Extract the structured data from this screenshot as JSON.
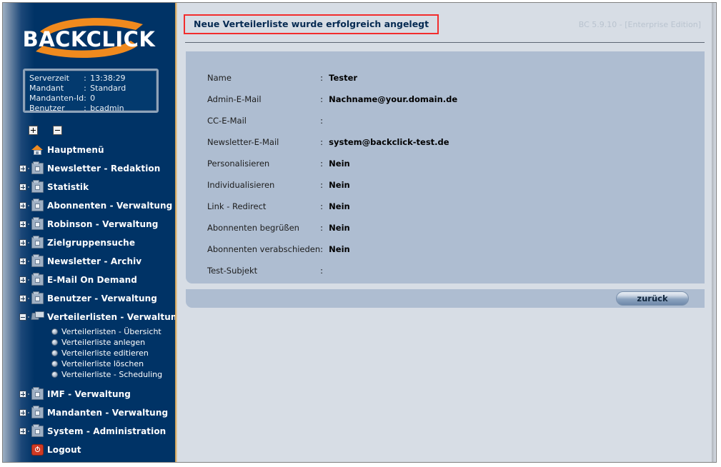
{
  "app": {
    "logo_text": "BACKCLICK",
    "version_label": "BC 5.9.10 - [Enterprise Edition]"
  },
  "sidebar": {
    "server_info": [
      {
        "key": "Serverzeit",
        "colon": ":",
        "value": "13:38:29"
      },
      {
        "key": "Mandant",
        "colon": ":",
        "value": "Standard"
      },
      {
        "key": "Mandanten-Id",
        "colon": ":",
        "value": "0"
      },
      {
        "key": "Benutzer",
        "colon": ":",
        "value": "bcadmin"
      }
    ],
    "tree_toggles": {
      "expand_all": "expand-all-icon",
      "collapse_all": "collapse-all-icon"
    },
    "items": [
      {
        "label": "Hauptmenü",
        "icon": "home-icon",
        "expandable": false,
        "expanded": false
      },
      {
        "label": "Newsletter - Redaktion",
        "icon": "folder-icon",
        "expandable": true,
        "expanded": false
      },
      {
        "label": "Statistik",
        "icon": "folder-icon",
        "expandable": true,
        "expanded": false
      },
      {
        "label": "Abonnenten - Verwaltung",
        "icon": "folder-icon",
        "expandable": true,
        "expanded": false
      },
      {
        "label": "Robinson - Verwaltung",
        "icon": "folder-icon",
        "expandable": true,
        "expanded": false
      },
      {
        "label": "Zielgruppensuche",
        "icon": "folder-icon",
        "expandable": true,
        "expanded": false
      },
      {
        "label": "Newsletter - Archiv",
        "icon": "folder-icon",
        "expandable": true,
        "expanded": false
      },
      {
        "label": "E-Mail On Demand",
        "icon": "folder-icon",
        "expandable": true,
        "expanded": false
      },
      {
        "label": "Benutzer - Verwaltung",
        "icon": "folder-icon",
        "expandable": true,
        "expanded": false
      },
      {
        "label": "Verteilerlisten - Verwaltung",
        "icon": "folder-open-icon",
        "expandable": true,
        "expanded": true
      },
      {
        "label": "IMF - Verwaltung",
        "icon": "folder-icon",
        "expandable": true,
        "expanded": false
      },
      {
        "label": "Mandanten - Verwaltung",
        "icon": "folder-icon",
        "expandable": true,
        "expanded": false
      },
      {
        "label": "System - Administration",
        "icon": "folder-icon",
        "expandable": true,
        "expanded": false
      },
      {
        "label": "Logout",
        "icon": "logout-icon",
        "expandable": false,
        "expanded": false
      }
    ],
    "submenu": [
      {
        "label": "Verteilerlisten - Übersicht"
      },
      {
        "label": "Verteilerliste anlegen"
      },
      {
        "label": "Verteilerliste editieren"
      },
      {
        "label": "Verteilerliste löschen"
      },
      {
        "label": "Verteilerliste - Scheduling"
      }
    ]
  },
  "main": {
    "status_message": "Neue Verteilerliste wurde erfolgreich angelegt",
    "details": [
      {
        "key": "Name",
        "colon": ":",
        "value": "Tester"
      },
      {
        "key": "Admin-E-Mail",
        "colon": ":",
        "value": "Nachname@your.domain.de"
      },
      {
        "key": "CC-E-Mail",
        "colon": ":",
        "value": ""
      },
      {
        "key": "Newsletter-E-Mail",
        "colon": ":",
        "value": "system@backclick-test.de"
      },
      {
        "key": "Personalisieren",
        "colon": ":",
        "value": "Nein"
      },
      {
        "key": "Individualisieren",
        "colon": ":",
        "value": "Nein"
      },
      {
        "key": "Link - Redirect",
        "colon": ":",
        "value": "Nein"
      },
      {
        "key": "Abonnenten begrüßen",
        "colon": ":",
        "value": "Nein"
      },
      {
        "key": "Abonnenten verabschieden",
        "colon": ":",
        "value": "Nein"
      },
      {
        "key": "Test-Subjekt",
        "colon": ":",
        "value": ""
      }
    ],
    "back_button": "zurück"
  },
  "colors": {
    "sidebar_dark": "#003366",
    "sidebar_divider": "#d9a martian",
    "panel": "#aebdd1",
    "content_bg": "#d7dde5",
    "status_border": "#f22d2d",
    "status_text": "#062a52",
    "accent_orange": "#ef8b21"
  }
}
